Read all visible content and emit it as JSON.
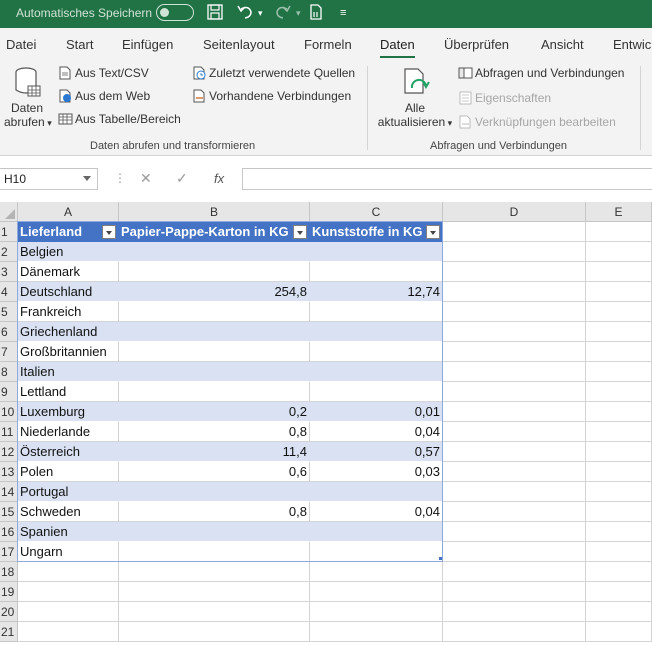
{
  "titlebar": {
    "autosave_label": "Automatisches Speichern",
    "bg_color": "#217346"
  },
  "tabs": [
    "Datei",
    "Start",
    "Einfügen",
    "Seitenlayout",
    "Formeln",
    "Daten",
    "Überprüfen",
    "Ansicht",
    "Entwic"
  ],
  "active_tab": "Daten",
  "ribbon": {
    "get_data_line1": "Daten",
    "get_data_line2": "abrufen",
    "from_text": "Aus Text/CSV",
    "from_web": "Aus dem Web",
    "from_table": "Aus Tabelle/Bereich",
    "recent_sources": "Zuletzt verwendete Quellen",
    "existing_connections": "Vorhandene Verbindungen",
    "group1_label": "Daten abrufen und transformieren",
    "refresh_line1": "Alle",
    "refresh_line2": "aktualisieren",
    "queries_connections": "Abfragen und Verbindungen",
    "properties": "Eigenschaften",
    "edit_links": "Verknüpfungen bearbeiten",
    "group2_label": "Abfragen und Verbindungen"
  },
  "formula_bar": {
    "name_box": "H10",
    "fx_label": "fx",
    "formula": ""
  },
  "sheet": {
    "columns": [
      "A",
      "B",
      "C",
      "D",
      "E"
    ],
    "rows": [
      "1",
      "2",
      "3",
      "4",
      "5",
      "6",
      "7",
      "8",
      "9",
      "10",
      "11",
      "12",
      "13",
      "14",
      "15",
      "16",
      "17",
      "18",
      "19",
      "20",
      "21"
    ],
    "table_header": [
      "Lieferland",
      "Papier-Pappe-Karton in KG",
      "Kunststoffe in KG"
    ],
    "table_rows": [
      [
        "Belgien",
        "",
        ""
      ],
      [
        "Dänemark",
        "",
        ""
      ],
      [
        "Deutschland",
        "254,8",
        "12,74"
      ],
      [
        "Frankreich",
        "",
        ""
      ],
      [
        "Griechenland",
        "",
        ""
      ],
      [
        "Großbritannien",
        "",
        ""
      ],
      [
        "Italien",
        "",
        ""
      ],
      [
        "Lettland",
        "",
        ""
      ],
      [
        "Luxemburg",
        "0,2",
        "0,01"
      ],
      [
        "Niederlande",
        "0,8",
        "0,04"
      ],
      [
        "Österreich",
        "11,4",
        "0,57"
      ],
      [
        "Polen",
        "0,6",
        "0,03"
      ],
      [
        "Portugal",
        "",
        ""
      ],
      [
        "Schweden",
        "0,8",
        "0,04"
      ],
      [
        "Spanien",
        "",
        ""
      ],
      [
        "Ungarn",
        "",
        ""
      ]
    ],
    "header_color": "#4472c4",
    "band_color": "#d9e1f2"
  }
}
